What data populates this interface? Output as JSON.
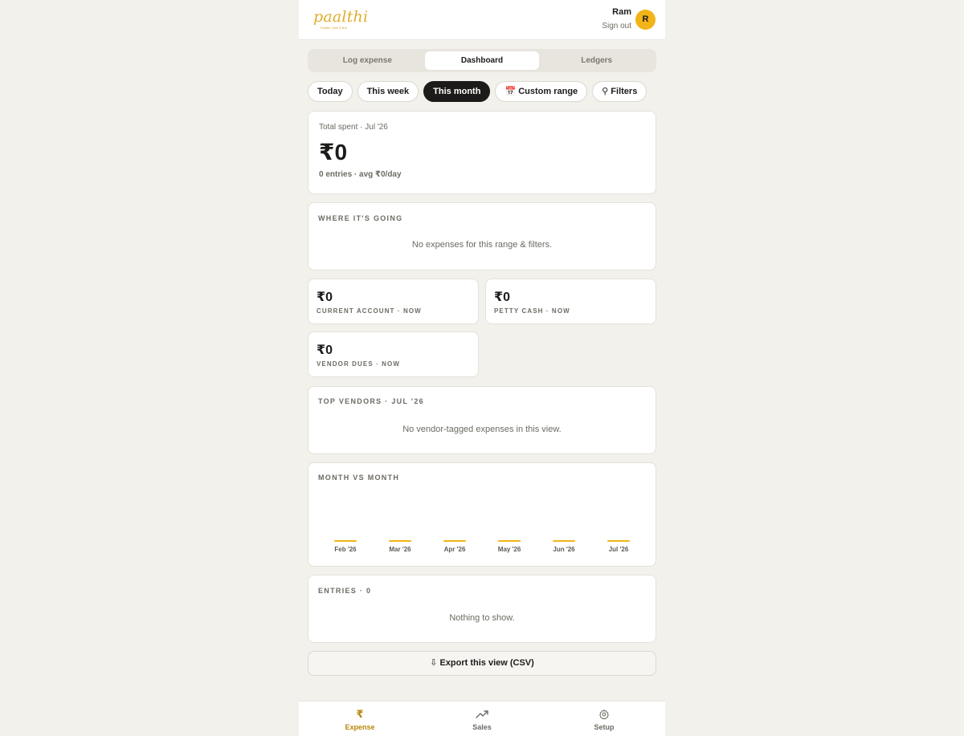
{
  "brand": {
    "logo_text": "paalthi",
    "tagline": "Paalthi Cafe & Bar"
  },
  "user": {
    "name": "Ram",
    "signout_label": "Sign out",
    "avatar_initial": "R"
  },
  "tabs": [
    {
      "label": "Log expense",
      "active": false
    },
    {
      "label": "Dashboard",
      "active": true
    },
    {
      "label": "Ledgers",
      "active": false
    }
  ],
  "ranges": {
    "today": "Today",
    "week": "This week",
    "month": "This month",
    "custom": "Custom range",
    "custom_icon": "calendar-icon",
    "filters": "Filters",
    "filters_icon": "pin-icon",
    "selected": "This month"
  },
  "summary": {
    "caption": "Total spent · Jul '26",
    "amount": "₹0",
    "detail": "0 entries · avg ₹0/day"
  },
  "where": {
    "title": "Where it's going",
    "empty": "No expenses for this range & filters."
  },
  "stats": {
    "current": {
      "amount": "₹0",
      "label": "Current account · now"
    },
    "petty": {
      "amount": "₹0",
      "label": "Petty cash · now"
    },
    "vendor": {
      "amount": "₹0",
      "label": "Vendor dues · now"
    }
  },
  "vendors": {
    "title": "Top vendors · Jul '26",
    "empty": "No vendor-tagged expenses in this view."
  },
  "mvm": {
    "title": "Month vs month"
  },
  "chart_data": {
    "type": "bar",
    "categories": [
      "Feb '26",
      "Mar '26",
      "Apr '26",
      "May '26",
      "Jun '26",
      "Jul '26"
    ],
    "values": [
      0,
      0,
      0,
      0,
      0,
      0
    ],
    "title": "Month vs month",
    "xlabel": "",
    "ylabel": "",
    "grid": false,
    "color": "#f2b417"
  },
  "entries": {
    "title": "Entries · 0",
    "empty": "Nothing to show."
  },
  "export": {
    "label": "Export this view (CSV)",
    "icon": "download-icon"
  },
  "nav": {
    "expense": "Expense",
    "sales": "Sales",
    "setup": "Setup",
    "active": "Expense"
  },
  "colors": {
    "accent": "#f2b417",
    "dark": "#1c1b19",
    "background": "#f3f1ec"
  }
}
